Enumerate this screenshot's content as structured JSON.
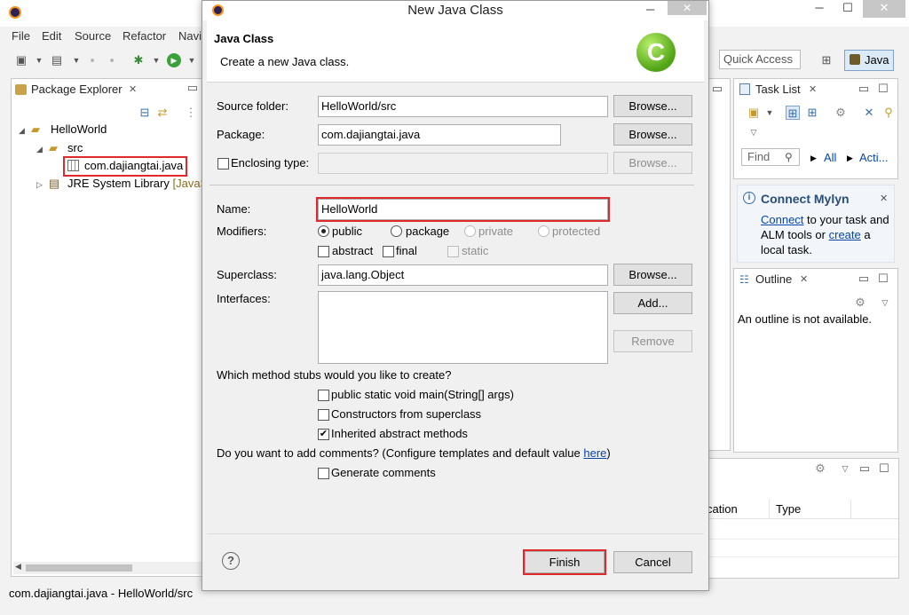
{
  "window": {
    "minimize": "─",
    "maximize": "☐",
    "close": "✕"
  },
  "menu": [
    "File",
    "Edit",
    "Source",
    "Refactor",
    "Navi"
  ],
  "toolbar": {
    "quick_access": "Quick Access",
    "perspective": "Java"
  },
  "package_explorer": {
    "tab_label": "Package Explorer",
    "project": "HelloWorld",
    "src": "src",
    "package": "com.dajiangtai.java",
    "jre": "JRE System Library",
    "jre_suffix": "[JavaS"
  },
  "task_list": {
    "tab_label": "Task List",
    "find_placeholder": "Find",
    "all": "All",
    "activate": "Acti..."
  },
  "mylyn": {
    "title": "Connect Mylyn",
    "connect_link": "Connect",
    "text1": "to your task and",
    "text2": "ALM tools or",
    "create_link": "create",
    "text3": "a",
    "text4": "local task."
  },
  "outline": {
    "tab_label": "Outline",
    "message": "An outline is not available."
  },
  "bottom_panel": {
    "col_location": "cation",
    "col_type": "Type"
  },
  "status_bar": "com.dajiangtai.java - HelloWorld/src",
  "dialog": {
    "title": "New Java Class",
    "heading": "Java Class",
    "description": "Create a new Java class.",
    "source_folder_label": "Source folder:",
    "source_folder_value": "HelloWorld/src",
    "package_label": "Package:",
    "package_value": "com.dajiangtai.java",
    "enclosing_label": "Enclosing type:",
    "browse": "Browse...",
    "name_label": "Name:",
    "name_value": "HelloWorld",
    "modifiers_label": "Modifiers:",
    "mod_public": "public",
    "mod_package": "package",
    "mod_private": "private",
    "mod_protected": "protected",
    "mod_abstract": "abstract",
    "mod_final": "final",
    "mod_static": "static",
    "superclass_label": "Superclass:",
    "superclass_value": "java.lang.Object",
    "interfaces_label": "Interfaces:",
    "add": "Add...",
    "remove": "Remove",
    "stubs_question": "Which method stubs would you like to create?",
    "stub_main": "public static void main(String[] args)",
    "stub_constructors": "Constructors from superclass",
    "stub_inherited": "Inherited abstract methods",
    "comments_question": "Do you want to add comments? (Configure templates and default value",
    "comments_link": "here",
    "comments_close": ")",
    "generate_comments": "Generate comments",
    "finish": "Finish",
    "cancel": "Cancel",
    "help": "?",
    "logo_letter": "C"
  }
}
